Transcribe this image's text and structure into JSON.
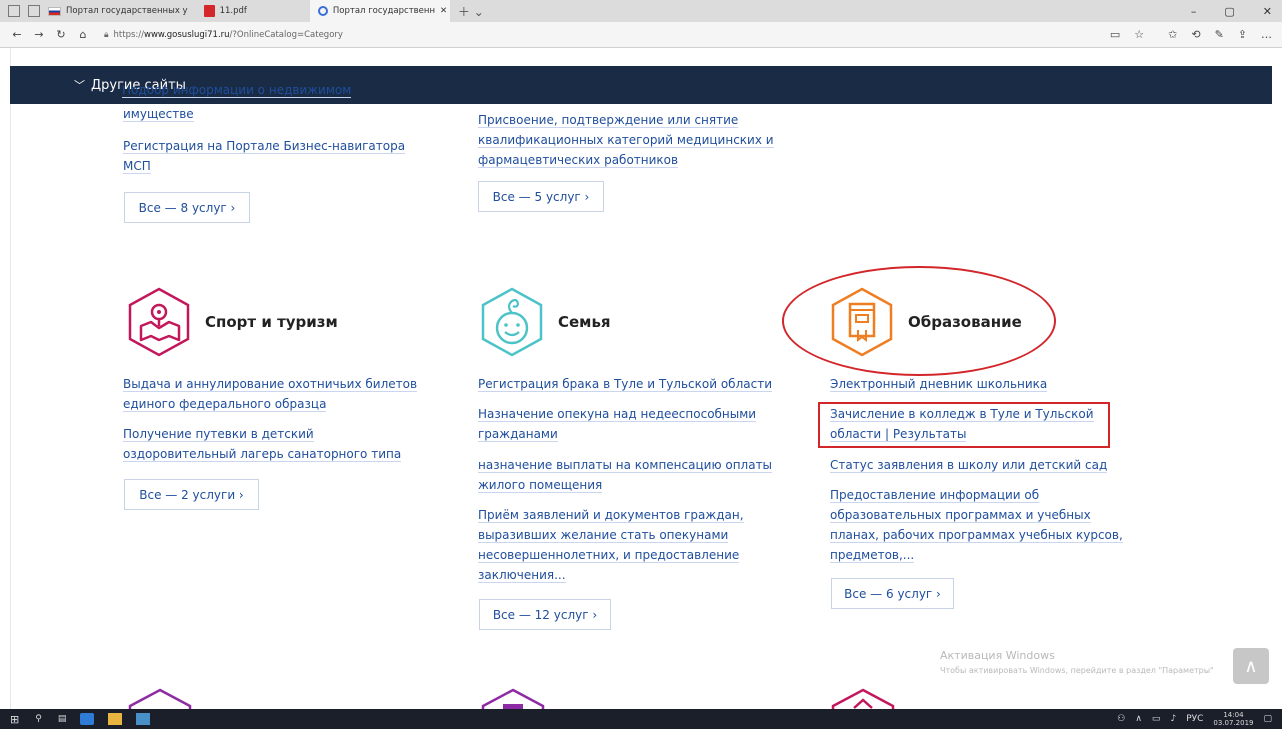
{
  "browser": {
    "tabs": [
      {
        "label": "Портал государственных у"
      },
      {
        "label": "11.pdf"
      },
      {
        "label": "Портал государственн",
        "active": true
      }
    ],
    "url_prefix": "https://",
    "url_domain": "www.gosuslugi71.ru",
    "url_path": "/?OnlineCatalog=Category"
  },
  "header": {
    "other_sites": "Другие сайты"
  },
  "top": {
    "col1": {
      "clipped": "Подбор информации о недвижимом",
      "links": [
        "имуществе",
        "Регистрация на Портале Бизнес-навигатора",
        "МСП"
      ],
      "button": "Все — 8 услуг ›"
    },
    "col2": {
      "links": [
        "Присвоение, подтверждение или снятие",
        "квалификационных категорий медицинских и",
        "фармацевтических работников"
      ],
      "button": "Все — 5 услуг ›"
    }
  },
  "categories": {
    "sport": {
      "title": "Спорт и туризм",
      "links": [
        "Выдача и аннулирование охотничьих билетов",
        "единого федерального образца",
        "Получение путевки в детский",
        "оздоровительный лагерь санаторного типа"
      ],
      "button": "Все — 2 услуги ›"
    },
    "family": {
      "title": "Семья",
      "links": [
        "Регистрация брака в Туле и Тульской области",
        "Назначение опекуна над недееспособными",
        "гражданами",
        "назначение выплаты на компенсацию оплаты",
        "жилого помещения",
        "Приём заявлений и документов граждан,",
        "выразивших желание стать опекунами",
        "несовершеннолетних, и предоставление",
        "заключения..."
      ],
      "button": "Все — 12 услуг ›"
    },
    "education": {
      "title": "Образование",
      "links": [
        "Электронный дневник школьника",
        "Зачисление в колледж в Туле и Тульской",
        "области | Результаты",
        "Статус заявления в школу или детский сад",
        "Предоставление информации об",
        "образовательных программах и учебных",
        "планах, рабочих программах учебных курсов,",
        "предметов,..."
      ],
      "button": "Все — 6 услуг ›"
    }
  },
  "watermark": {
    "title": "Активация Windows",
    "subtitle": "Чтобы активировать Windows, перейдите в раздел \"Параметры\""
  },
  "taskbar": {
    "lang": "РУС",
    "time": "14:04",
    "date": "03.07.2019"
  },
  "colors": {
    "link": "#1f4e9c",
    "sport": "#c2185b",
    "family": "#4cc3c9",
    "education": "#ef7d22",
    "highlight": "#d3262b",
    "header": "#1a2b46"
  }
}
